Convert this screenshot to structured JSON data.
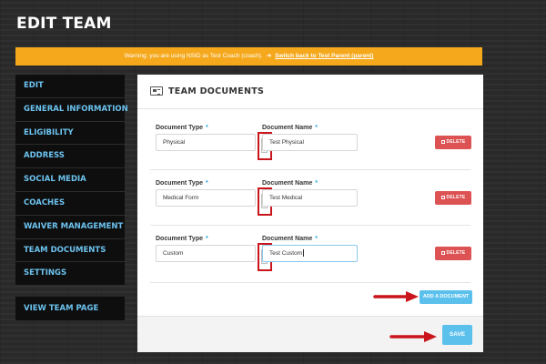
{
  "page": {
    "title": "EDIT TEAM"
  },
  "warning": {
    "text": "Warning: you are using NSID as Test Coach (coach).",
    "link_label": "Switch back to Test Parent (parent)"
  },
  "sidebar": {
    "items": [
      {
        "label": "EDIT"
      },
      {
        "label": "GENERAL INFORMATION"
      },
      {
        "label": "ELIGIBILITY"
      },
      {
        "label": "ADDRESS"
      },
      {
        "label": "SOCIAL MEDIA"
      },
      {
        "label": "COACHES"
      },
      {
        "label": "WAIVER MANAGEMENT"
      },
      {
        "label": "TEAM DOCUMENTS"
      },
      {
        "label": "SETTINGS"
      }
    ],
    "view_team_label": "VIEW TEAM PAGE"
  },
  "panel": {
    "title": "TEAM DOCUMENTS",
    "type_label": "Document Type",
    "name_label": "Document Name",
    "required_mark": "*",
    "delete_label": "DELETE",
    "documents": [
      {
        "type": "Physical",
        "name": "Test Physical"
      },
      {
        "type": "Medical Form",
        "name": "Test Medical"
      },
      {
        "type": "Custom",
        "name": "Test Custom"
      }
    ],
    "add_label": "ADD A DOCUMENT",
    "save_label": "SAVE"
  },
  "colors": {
    "warning_bg": "#f5a81c",
    "sidebar_text": "#6cc3ef",
    "primary_button": "#5bc0ec",
    "delete_button": "#dd5353",
    "annotation_red": "#c9151b"
  },
  "icons": {
    "panel_header": "document-icon",
    "warning_link": "switch-arrow-icon",
    "delete": "trash-icon",
    "select_toggle": "chevron-down-icon",
    "annotation": "red-arrow-icon"
  }
}
